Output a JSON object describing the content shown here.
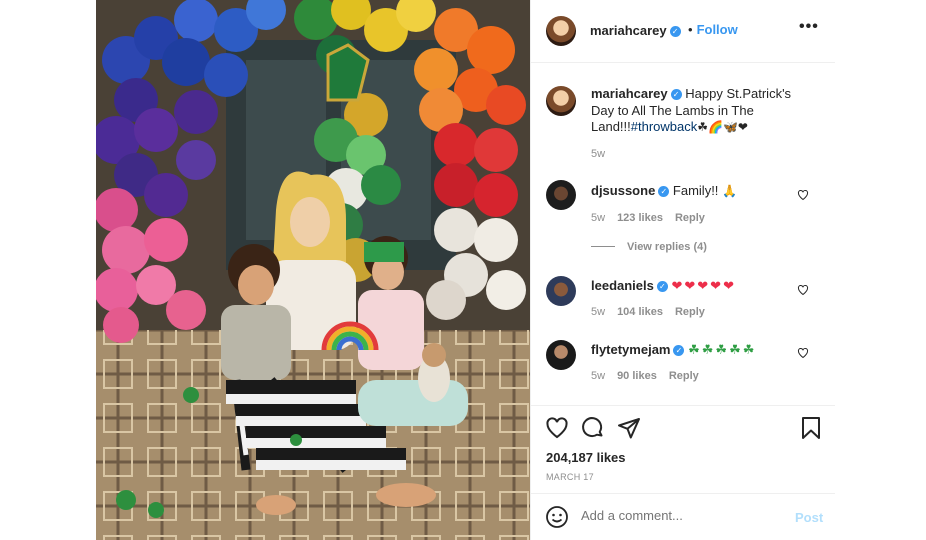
{
  "post": {
    "author": "mariahcarey",
    "follow_separator": "•",
    "follow_label": "Follow",
    "more_label": "•••",
    "caption": {
      "author": "mariahcarey",
      "text": "Happy St.Patrick's Day to All The Lambs in The Land!!!",
      "hashtag": "#throwback",
      "emojis": "☘🌈🦋❤",
      "time": "5w"
    },
    "comments": [
      {
        "user": "djsussone",
        "text": "Family!!",
        "emoji": "🙏",
        "time": "5w",
        "likes": "123 likes",
        "reply": "Reply"
      },
      {
        "user": "leedaniels",
        "text": "❤❤❤❤❤",
        "time": "5w",
        "likes": "104 likes",
        "reply": "Reply"
      },
      {
        "user": "flytetymejam",
        "text": "☘☘☘☘☘",
        "time": "5w",
        "likes": "90 likes",
        "reply": "Reply"
      }
    ],
    "view_replies": "View replies (4)",
    "likes": "204,187 likes",
    "date": "MARCH 17",
    "comment_placeholder": "Add a comment...",
    "post_label": "Post"
  },
  "icons": {
    "verified": "verified-badge-icon",
    "like": "heart-icon",
    "comment": "comment-icon",
    "share": "send-icon",
    "save": "bookmark-icon",
    "emoji": "smiley-icon"
  },
  "colors": {
    "link_blue": "#3897f0",
    "hashtag": "#003569",
    "muted": "#8e8e8e",
    "post_disabled": "#b2dffc"
  }
}
